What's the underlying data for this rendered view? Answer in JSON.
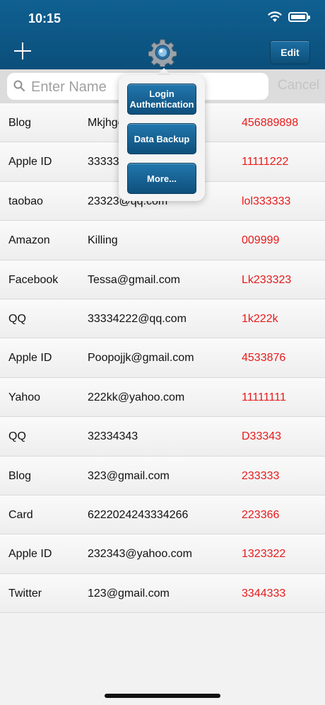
{
  "status_bar": {
    "time": "10:15"
  },
  "nav": {
    "edit_label": "Edit"
  },
  "search": {
    "placeholder": "Enter Name",
    "cancel_label": "Cancel"
  },
  "popover": {
    "login_auth": "Login Authentication",
    "data_backup": "Data Backup",
    "more": "More..."
  },
  "rows": [
    {
      "name": "Blog",
      "account": "Mkjhgc",
      "password": "456889898"
    },
    {
      "name": "Apple ID",
      "account": "33333",
      "password": "11111222"
    },
    {
      "name": "taobao",
      "account": "23323@qq.com",
      "password": "lol333333"
    },
    {
      "name": "Amazon",
      "account": "Killing",
      "password": "009999"
    },
    {
      "name": "Facebook",
      "account": "Tessa@gmail.com",
      "password": "Lk233323"
    },
    {
      "name": "QQ",
      "account": "33334222@qq.com",
      "password": "1k222k"
    },
    {
      "name": "Apple ID",
      "account": "Poopojjk@gmail.com",
      "password": "4533876"
    },
    {
      "name": "Yahoo",
      "account": "222kk@yahoo.com",
      "password": "11111111"
    },
    {
      "name": "QQ",
      "account": "32334343",
      "password": "D33343"
    },
    {
      "name": "Blog",
      "account": "323@gmail.com",
      "password": "233333"
    },
    {
      "name": "Card",
      "account": "6222024243334266",
      "password": "223366"
    },
    {
      "name": "Apple ID",
      "account": "232343@yahoo.com",
      "password": "1323322"
    },
    {
      "name": "Twitter",
      "account": "123@gmail.com",
      "password": "3344333"
    }
  ],
  "colors": {
    "nav_blue": "#0f6091",
    "password_red": "#e81a1a"
  }
}
